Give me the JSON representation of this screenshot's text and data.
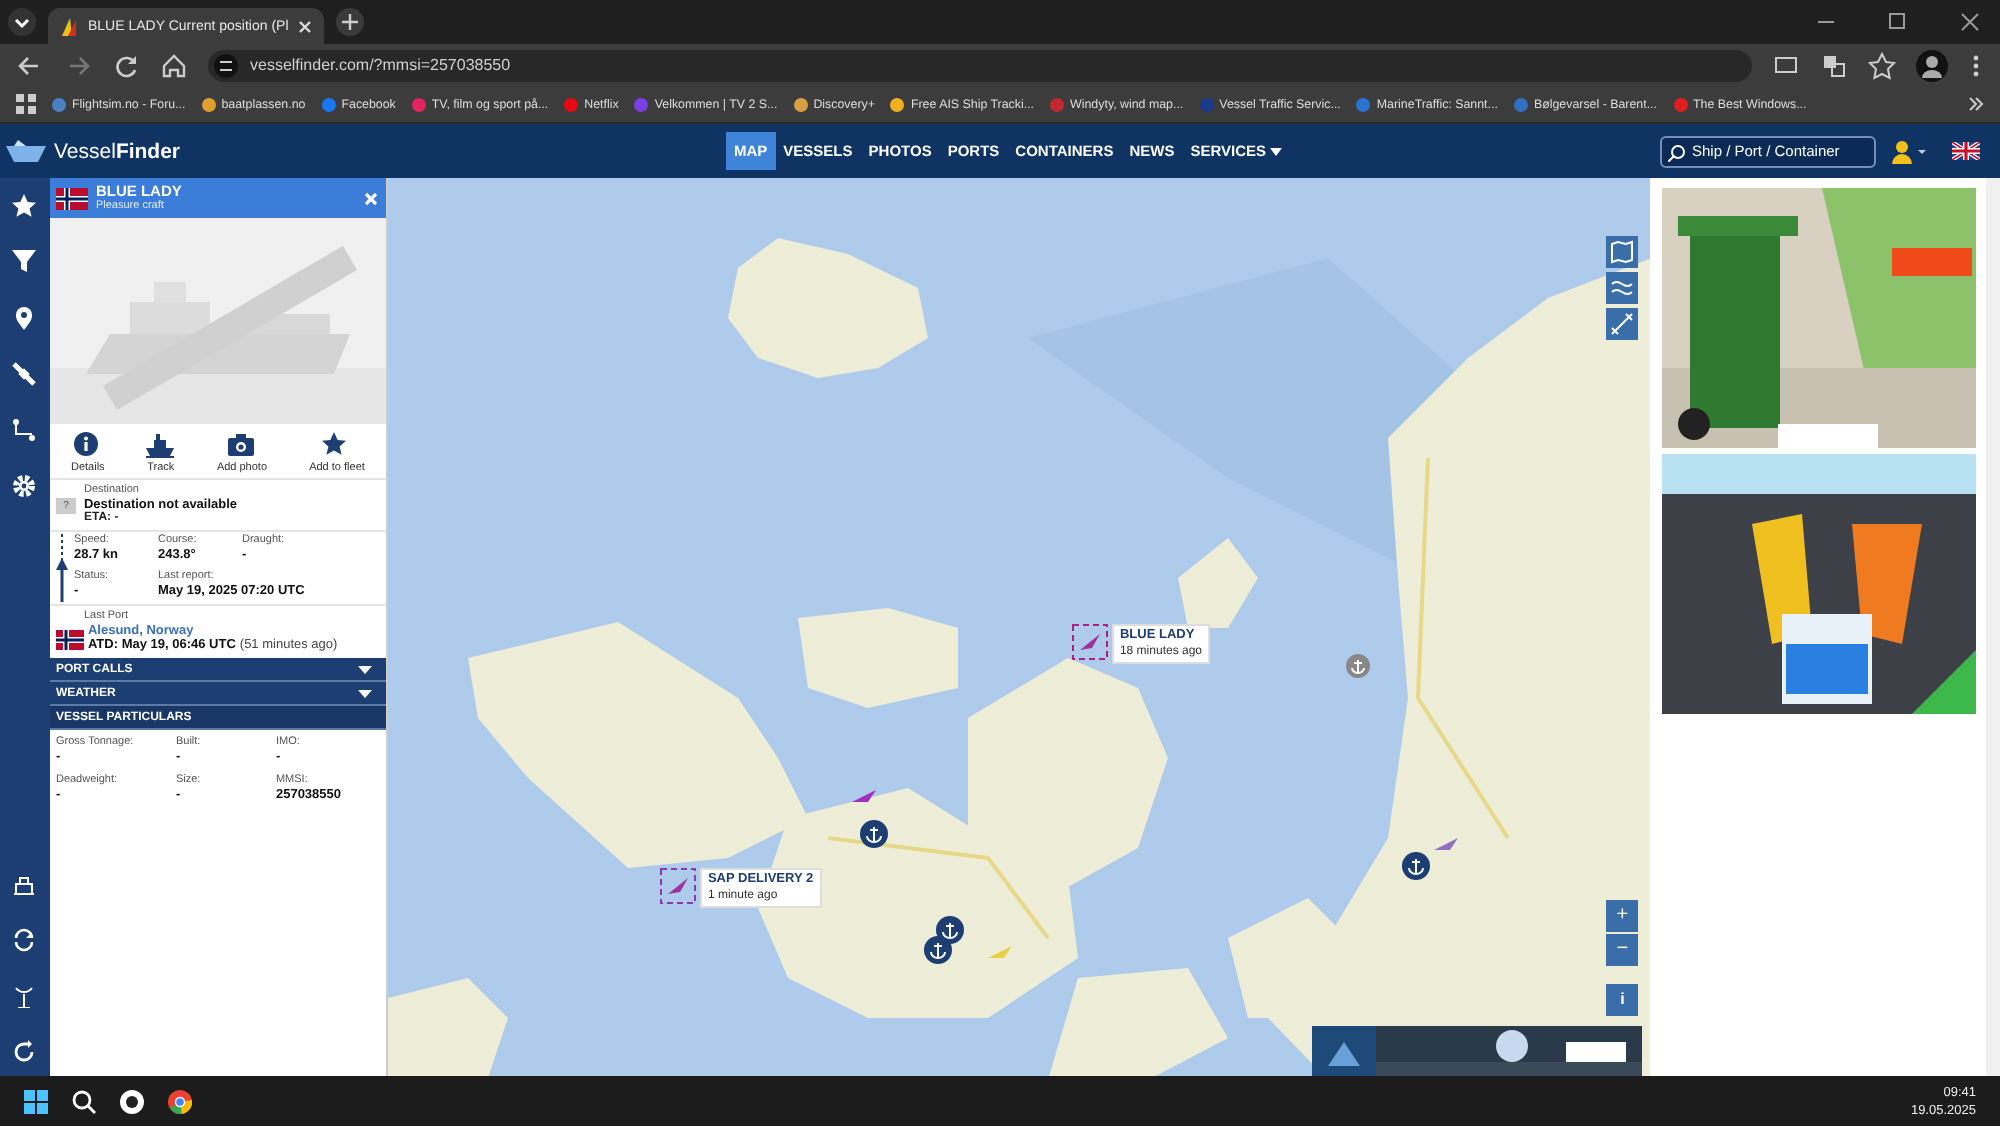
{
  "browser": {
    "tab_title": "BLUE LADY Current position (Pl",
    "url": "vesselfinder.com/?mmsi=257038550",
    "bookmarks": [
      {
        "label": "Flightsim.no - Foru...",
        "color": "#4a7fc1"
      },
      {
        "label": "baatplassen.no",
        "color": "#e0a030"
      },
      {
        "label": "Facebook",
        "color": "#1877f2"
      },
      {
        "label": "TV, film og sport på...",
        "color": "#e0245e"
      },
      {
        "label": "Netflix",
        "color": "#e50914"
      },
      {
        "label": "Velkommen | TV 2 S...",
        "color": "#7b3fe4"
      },
      {
        "label": "Discovery+",
        "color": "#d8a040"
      },
      {
        "label": "Free AIS Ship Tracki...",
        "color": "#f0b020"
      },
      {
        "label": "Windyty, wind map...",
        "color": "#c0282d"
      },
      {
        "label": "Vessel Traffic Servic...",
        "color": "#1a3a8a"
      },
      {
        "label": "MarineTraffic: Sannt...",
        "color": "#2a72d0"
      },
      {
        "label": "Bølgevarsel - Barent...",
        "color": "#3070c0"
      },
      {
        "label": "The Best Windows...",
        "color": "#e02020"
      }
    ]
  },
  "site": {
    "logo": "Vessel**Finder**",
    "nav": [
      {
        "label": "MAP",
        "selected": true
      },
      {
        "label": "VESSELS",
        "selected": false
      },
      {
        "label": "PHOTOS",
        "selected": false
      },
      {
        "label": "PORTS",
        "selected": false
      },
      {
        "label": "CONTAINERS",
        "selected": false
      },
      {
        "label": "NEWS",
        "selected": false
      },
      {
        "label": "SERVICES",
        "selected": false,
        "dropdown": true
      }
    ],
    "search": {
      "placeholder": "Ship / Port / Container"
    }
  },
  "vessel": {
    "name": "BLUE LADY",
    "type": "Pleasure craft",
    "actions": [
      {
        "label": "Details",
        "kind": "info"
      },
      {
        "label": "Track",
        "kind": "ship"
      },
      {
        "label": "Add photo",
        "kind": "camera"
      },
      {
        "label": "Add to fleet",
        "kind": "star"
      }
    ],
    "destination_label": "Destination",
    "destination_flag": "?",
    "destination": "Destination not available",
    "eta": "ETA: -",
    "facts": [
      {
        "label": "Speed:",
        "value": "28.7 kn"
      },
      {
        "label": "Course:",
        "value": "243.8°"
      },
      {
        "label": "Draught:",
        "value": "-"
      },
      {
        "label": "Status:",
        "value": "-"
      },
      {
        "label": "Last report:",
        "value": "May 19, 2025 07:20 UTC",
        "wide": true
      }
    ],
    "last_port_label": "Last Port",
    "last_port": "Alesund, Norway",
    "atd": "ATD: May 19, 06:46 UTC",
    "atd_ago": "(51 minutes ago)",
    "sections": [
      {
        "label": "PORT CALLS",
        "expanded": false
      },
      {
        "label": "WEATHER",
        "expanded": false
      },
      {
        "label": "VESSEL PARTICULARS",
        "expanded": true
      }
    ],
    "particulars": [
      {
        "label": "Gross Tonnage:",
        "value": "-"
      },
      {
        "label": "Built:",
        "value": "-"
      },
      {
        "label": "IMO:",
        "value": "-"
      },
      {
        "label": "Deadweight:",
        "value": "-"
      },
      {
        "label": "Size:",
        "value": "-"
      },
      {
        "label": "MMSI:",
        "value": "257038550"
      }
    ]
  },
  "map": {
    "vessel_labels": [
      {
        "name": "BLUE LADY",
        "age": "18 minutes ago",
        "selected": true
      },
      {
        "name": "SAP DELIVERY 2",
        "age": "1 minute ago",
        "selected": false
      }
    ],
    "zoom_in": "+",
    "zoom_out": "−",
    "info": "i"
  },
  "taskbar": {
    "time": "09:41",
    "date": "19.05.2025"
  }
}
